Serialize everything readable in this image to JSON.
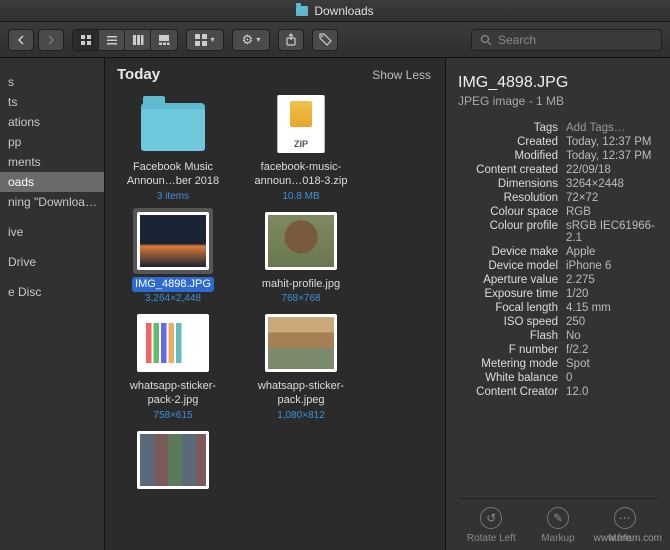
{
  "window": {
    "title": "Downloads"
  },
  "toolbar": {
    "search_placeholder": "Search"
  },
  "sidebar": {
    "items": [
      "",
      "s",
      "ts",
      "ations",
      "pp",
      "ments",
      "oads",
      "ning \"Downloa…",
      "",
      "ive",
      "",
      " Drive",
      "",
      "e Disc",
      "",
      ""
    ],
    "selected_index": 6
  },
  "section": {
    "heading": "Today",
    "toggle": "Show Less"
  },
  "files": [
    {
      "name": "Facebook Music Announ…ber 2018",
      "meta": "3 items",
      "kind": "folder"
    },
    {
      "name": "facebook-music-announ…018-3.zip",
      "meta": "10.8 MB",
      "kind": "zip"
    },
    {
      "name": "IMG_4898.JPG",
      "meta": "3,264×2,448",
      "kind": "sunset",
      "selected": true
    },
    {
      "name": "mahit-profile.jpg",
      "meta": "768×768",
      "kind": "person"
    },
    {
      "name": "whatsapp-sticker-pack-2.jpg",
      "meta": "758×615",
      "kind": "stickers"
    },
    {
      "name": "whatsapp-sticker-pack.jpeg",
      "meta": "1,080×812",
      "kind": "stickera"
    },
    {
      "name": "",
      "meta": "",
      "kind": "collage"
    }
  ],
  "preview": {
    "title": "IMG_4898.JPG",
    "subtitle": "JPEG image - 1 MB",
    "add_tags": "Add Tags…",
    "rows": [
      {
        "k": "Tags",
        "v": "Add Tags…",
        "link": true
      },
      {
        "k": "Created",
        "v": "Today, 12:37 PM"
      },
      {
        "k": "Modified",
        "v": "Today, 12:37 PM"
      },
      {
        "k": "Content created",
        "v": "22/09/18"
      },
      {
        "k": "Dimensions",
        "v": "3264×2448"
      },
      {
        "k": "Resolution",
        "v": "72×72"
      },
      {
        "k": "Colour space",
        "v": "RGB"
      },
      {
        "k": "Colour profile",
        "v": "sRGB IEC61966-2.1"
      },
      {
        "k": "Device make",
        "v": "Apple"
      },
      {
        "k": "Device model",
        "v": "iPhone 6"
      },
      {
        "k": "Aperture value",
        "v": "2.275"
      },
      {
        "k": "Exposure time",
        "v": "1/20"
      },
      {
        "k": "Focal length",
        "v": "4.15 mm"
      },
      {
        "k": "ISO speed",
        "v": "250"
      },
      {
        "k": "Flash",
        "v": "No"
      },
      {
        "k": "F number",
        "v": "f/2.2"
      },
      {
        "k": "Metering mode",
        "v": "Spot"
      },
      {
        "k": "White balance",
        "v": "0"
      },
      {
        "k": "Content Creator",
        "v": "12.0"
      }
    ],
    "actions": [
      {
        "label": "Rotate Left",
        "icon": "↺"
      },
      {
        "label": "Markup",
        "icon": "✎"
      },
      {
        "label": "More…",
        "icon": "⋯"
      }
    ]
  },
  "zip_label": "ZIP",
  "watermark": "www.frfam.com"
}
